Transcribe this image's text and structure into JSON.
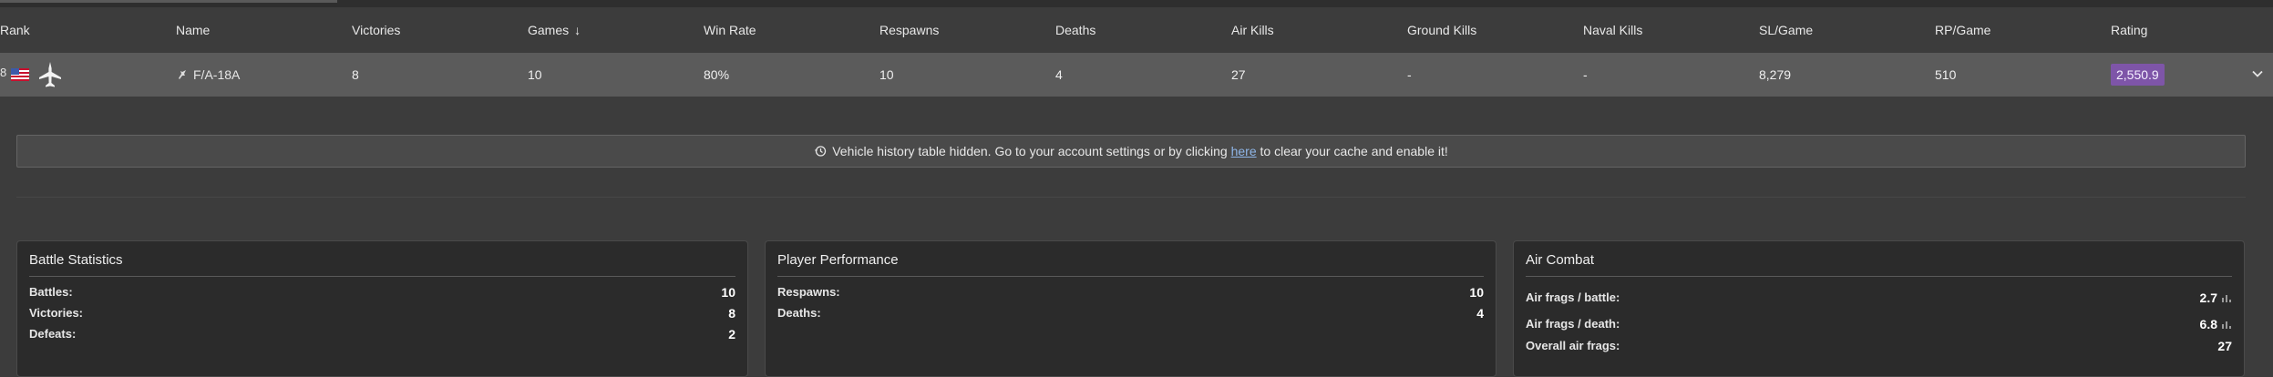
{
  "table": {
    "headers": {
      "rank": "Rank",
      "name": "Name",
      "victories": "Victories",
      "games": "Games",
      "win_rate": "Win Rate",
      "respawns": "Respawns",
      "deaths": "Deaths",
      "air_kills": "Air Kills",
      "ground_kills": "Ground Kills",
      "naval_kills": "Naval Kills",
      "sl_game": "SL/Game",
      "rp_game": "RP/Game",
      "rating": "Rating"
    },
    "sort_icon": "arrow-down-icon",
    "row": {
      "rank": "8",
      "nation_icon": "usa-flag-icon",
      "vehicle_type_icon": "jet-icon",
      "name": "F/A-18A",
      "victories": "8",
      "games": "10",
      "win_rate": "80%",
      "respawns": "10",
      "deaths": "4",
      "air_kills": "27",
      "ground_kills": "-",
      "naval_kills": "-",
      "sl_game": "8,279",
      "rp_game": "510",
      "rating": "2,550.9",
      "expand_icon": "chevron-down-icon"
    }
  },
  "notice": {
    "icon": "history-icon",
    "text_before": "Vehicle history table hidden. Go to your account settings or by clicking",
    "link_text": "here",
    "text_after": "to clear your cache and enable it!"
  },
  "panels": {
    "battle": {
      "title": "Battle Statistics",
      "rows": [
        {
          "label": "Battles:",
          "value": "10"
        },
        {
          "label": "Victories:",
          "value": "8"
        },
        {
          "label": "Defeats:",
          "value": "2"
        }
      ]
    },
    "performance": {
      "title": "Player Performance",
      "rows": [
        {
          "label": "Respawns:",
          "value": "10"
        },
        {
          "label": "Deaths:",
          "value": "4"
        }
      ]
    },
    "air": {
      "title": "Air Combat",
      "rows": [
        {
          "label": "Air frags / battle:",
          "value": "2.7",
          "icon": "bar-chart-icon"
        },
        {
          "label": "Air frags / death:",
          "value": "6.8",
          "icon": "bar-chart-icon"
        },
        {
          "label": "Overall air frags:",
          "value": "27"
        }
      ]
    }
  },
  "colors": {
    "background": "#3c3c3c",
    "row_highlight": "#5b5b5b",
    "rating_badge": "#7e55a8",
    "panel_bg": "#2b2b2b",
    "link": "#8fb6e8"
  }
}
